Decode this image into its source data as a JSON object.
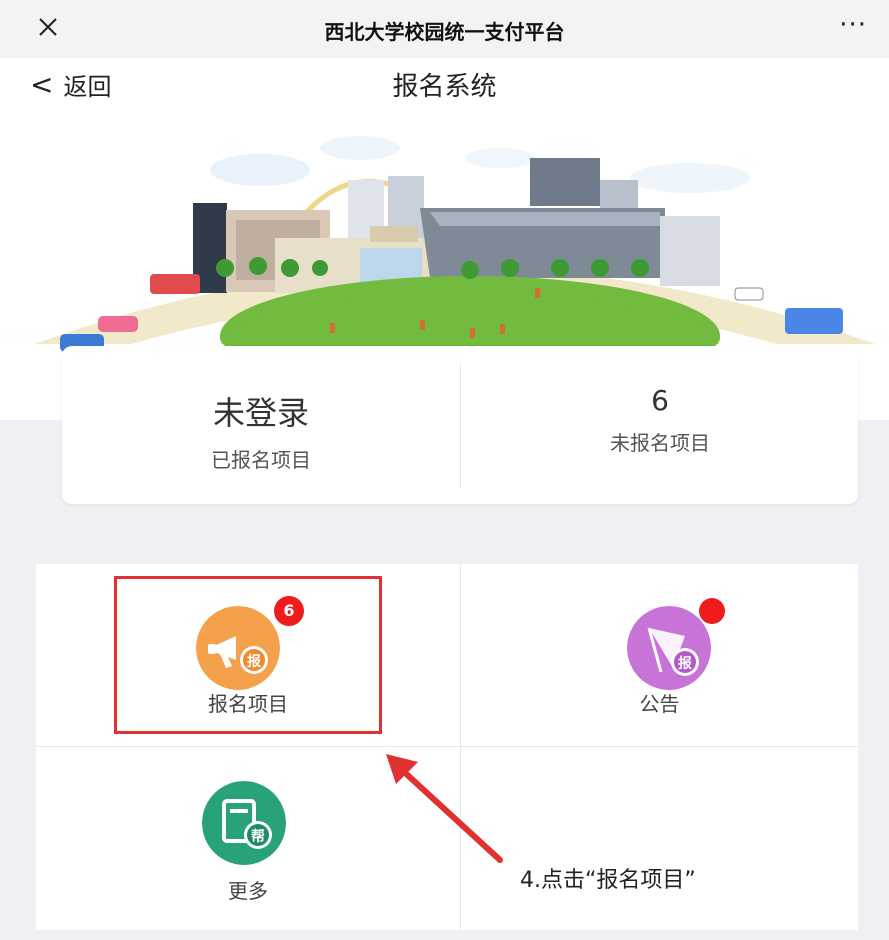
{
  "window": {
    "title": "西北大学校园统一支付平台",
    "close_icon": "close-icon",
    "more_icon": "more-dots-icon",
    "more_glyph": "···"
  },
  "nav": {
    "back_label": "返回",
    "back_chevron": "<",
    "page_title": "报名系统"
  },
  "stats": [
    {
      "value": "未登录",
      "label": "已报名项目"
    },
    {
      "value": "6",
      "label": "未报名项目"
    }
  ],
  "grid_items": [
    {
      "label": "报名项目",
      "icon": "megaphone-icon",
      "icon_text": "报",
      "color": "#f5a04a",
      "badge": "6"
    },
    {
      "label": "公告",
      "icon": "flag-icon",
      "icon_text": "报",
      "color": "#c773d8",
      "badge_dot": true
    },
    {
      "label": "更多",
      "icon": "help-book-icon",
      "icon_text": "帮",
      "color": "#27a27a"
    }
  ],
  "annotation": {
    "text": "4.点击“报名项目”",
    "color": "#e03030"
  }
}
